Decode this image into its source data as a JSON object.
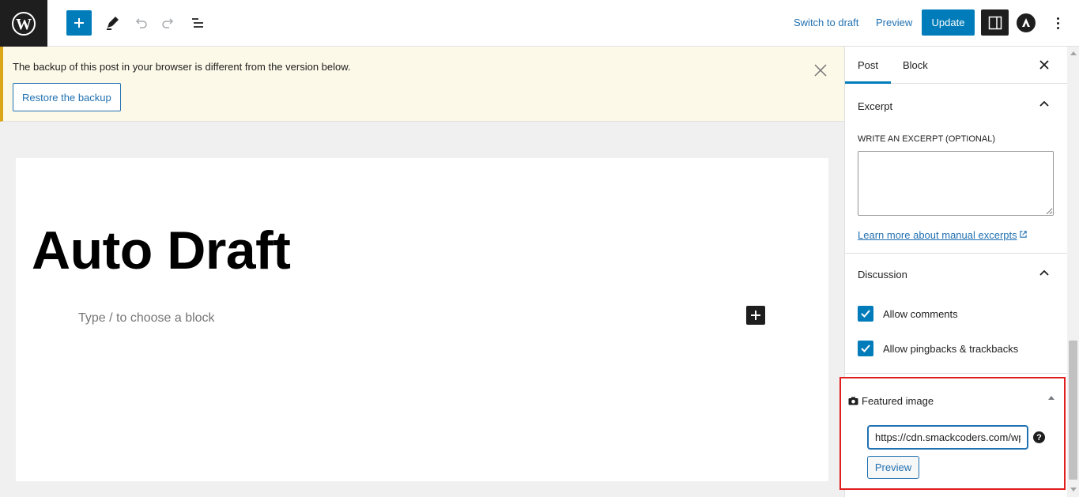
{
  "toolbar": {
    "logo_icon": "wordpress-icon",
    "inserter_icon": "plus-icon",
    "tools_icon": "pencil-icon",
    "undo_icon": "undo-icon",
    "redo_icon": "redo-icon",
    "list_view_icon": "list-view-icon",
    "switch_to_draft": "Switch to draft",
    "preview": "Preview",
    "update": "Update",
    "settings_icon": "sidebar-toggle-icon",
    "astra_icon": "astra-icon",
    "more_icon": "more-vertical-icon",
    "accent": "#007cba"
  },
  "notice": {
    "message": "The backup of this post in your browser is different from the version below.",
    "restore_label": "Restore the backup",
    "close_icon": "close-icon",
    "border_color": "#dba617",
    "background": "#fcf9e8"
  },
  "editor": {
    "post_title": "Auto Draft",
    "block_placeholder": "Type / to choose a block",
    "add_block_icon": "plus-icon"
  },
  "sidebar": {
    "tabs": [
      {
        "label": "Post",
        "active": true
      },
      {
        "label": "Block",
        "active": false
      }
    ],
    "close_icon": "close-icon",
    "excerpt": {
      "title": "Excerpt",
      "label": "WRITE AN EXCERPT (OPTIONAL)",
      "value": "",
      "link": "Learn more about manual excerpts",
      "link_icon": "external-link-icon",
      "expanded": true
    },
    "discussion": {
      "title": "Discussion",
      "expanded": true,
      "options": [
        {
          "label": "Allow comments",
          "checked": true
        },
        {
          "label": "Allow pingbacks & trackbacks",
          "checked": true
        }
      ]
    },
    "featured_image": {
      "title": "Featured image",
      "icon": "camera-icon",
      "url_value": "https://cdn.smackcoders.com/wp",
      "help_icon": "help-icon",
      "help_glyph": "?",
      "preview_label": "Preview",
      "highlight_color": "#e01e1e"
    }
  }
}
